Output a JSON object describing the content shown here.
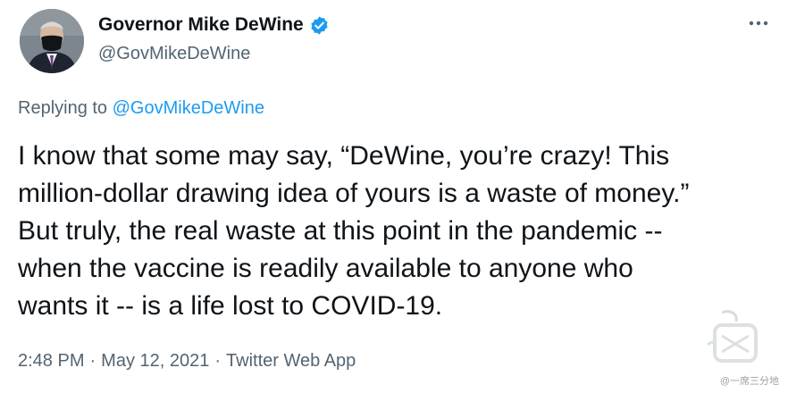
{
  "author": {
    "display_name": "Governor Mike DeWine",
    "handle": "@GovMikeDeWine",
    "verified": true,
    "verified_color": "#1d9bf0",
    "avatar_icon": "profile-photo-masked"
  },
  "reply": {
    "prefix": "Replying to",
    "target": "@GovMikeDeWine"
  },
  "tweet": {
    "lines": [
      "I know that some may say, “DeWine, you’re crazy!  This",
      "million-dollar drawing idea of yours is a waste of money.”",
      "But truly, the real waste at this point in the pandemic --",
      "when the vaccine is readily available to anyone who",
      "wants it -- is a life lost to COVID-19."
    ]
  },
  "meta": {
    "time": "2:48 PM",
    "separator": "·",
    "date": "May 12, 2021",
    "app": "Twitter Web App"
  },
  "more_icon": "ellipsis-icon",
  "watermark": {
    "text": "@一席三分地"
  },
  "colors": {
    "text_primary": "#0f1419",
    "text_secondary": "#536471",
    "link": "#1d9bf0"
  }
}
